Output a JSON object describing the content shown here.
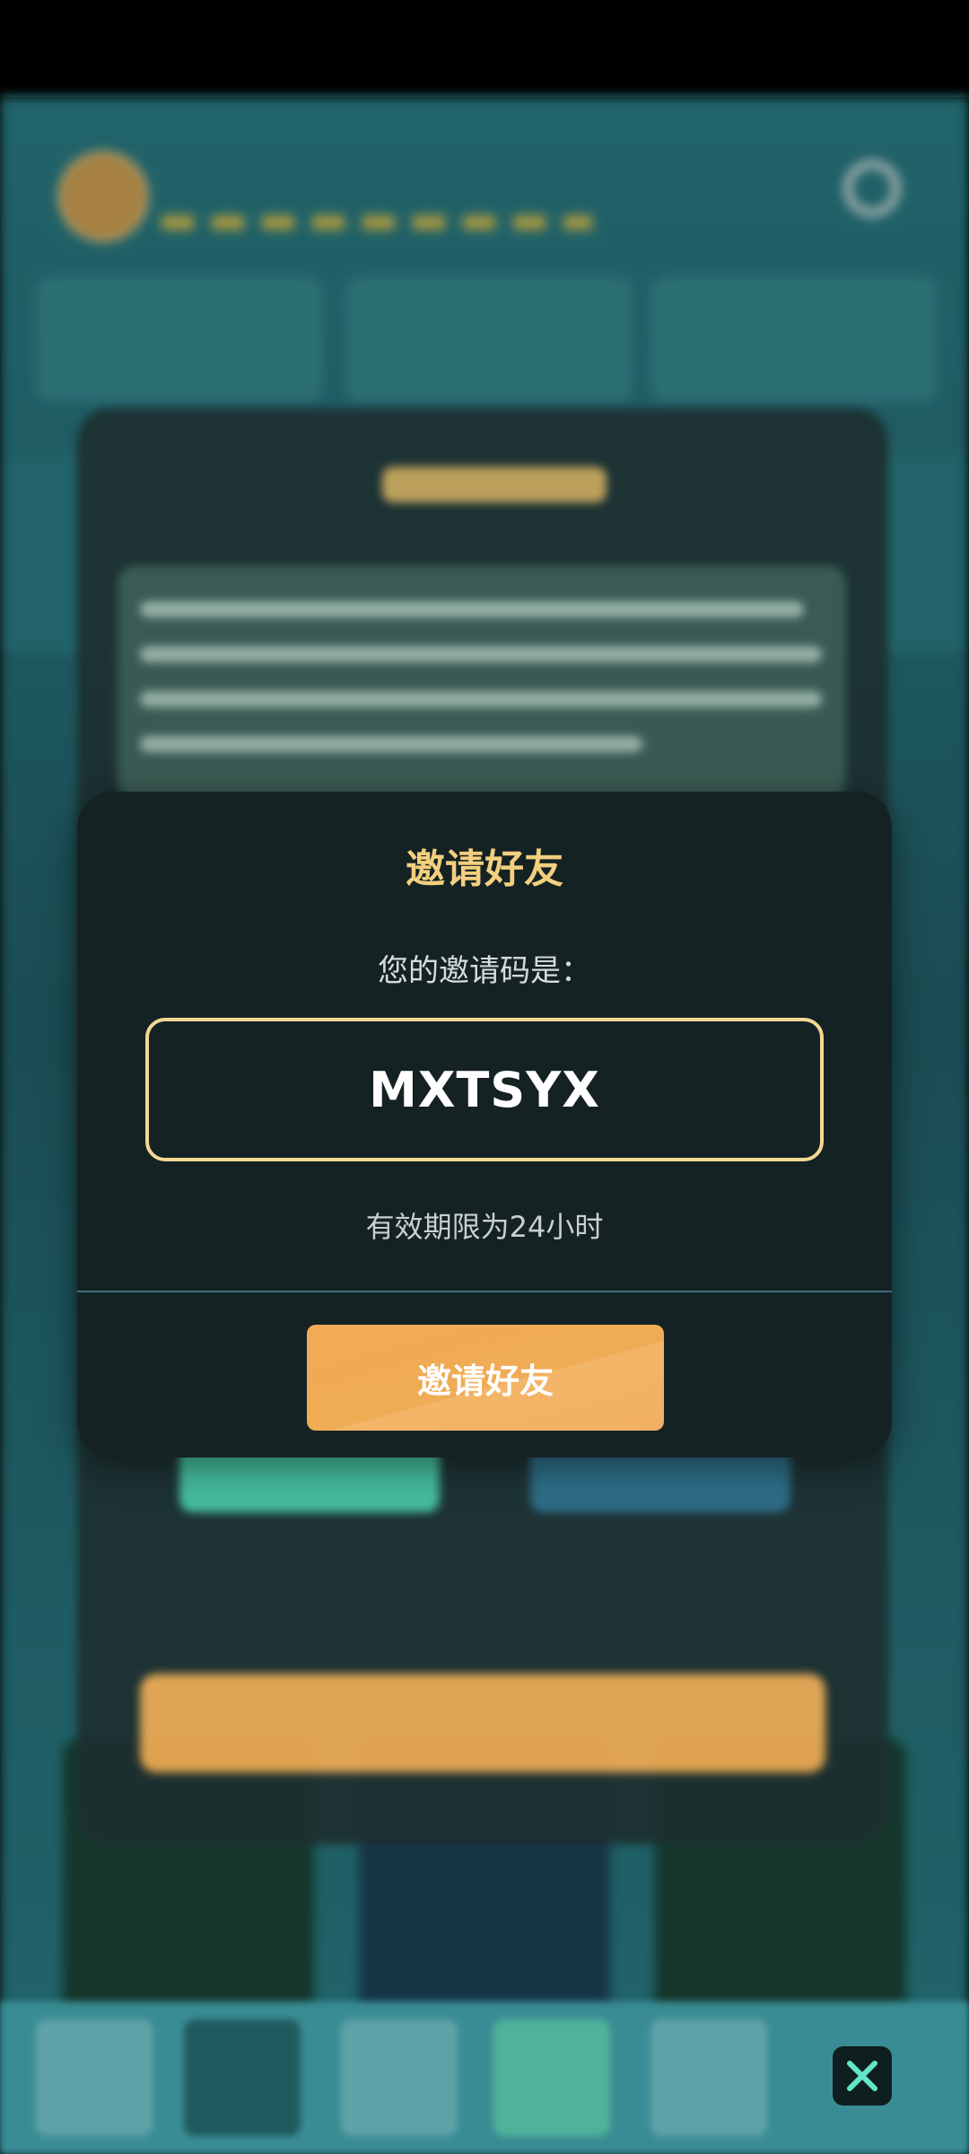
{
  "dialog": {
    "title": "邀请好友",
    "subtitle": "您的邀请码是：",
    "invite_code": "MXTSYX",
    "validity_note": "有效期限为24小时",
    "invite_button_label": "邀请好友"
  },
  "colors": {
    "accent_gold": "#f3cf7e",
    "button_orange": "#f0ab55",
    "modal_bg": "#152224",
    "code_border": "#f2d893"
  },
  "icons": {
    "nav_close": "close-icon"
  }
}
